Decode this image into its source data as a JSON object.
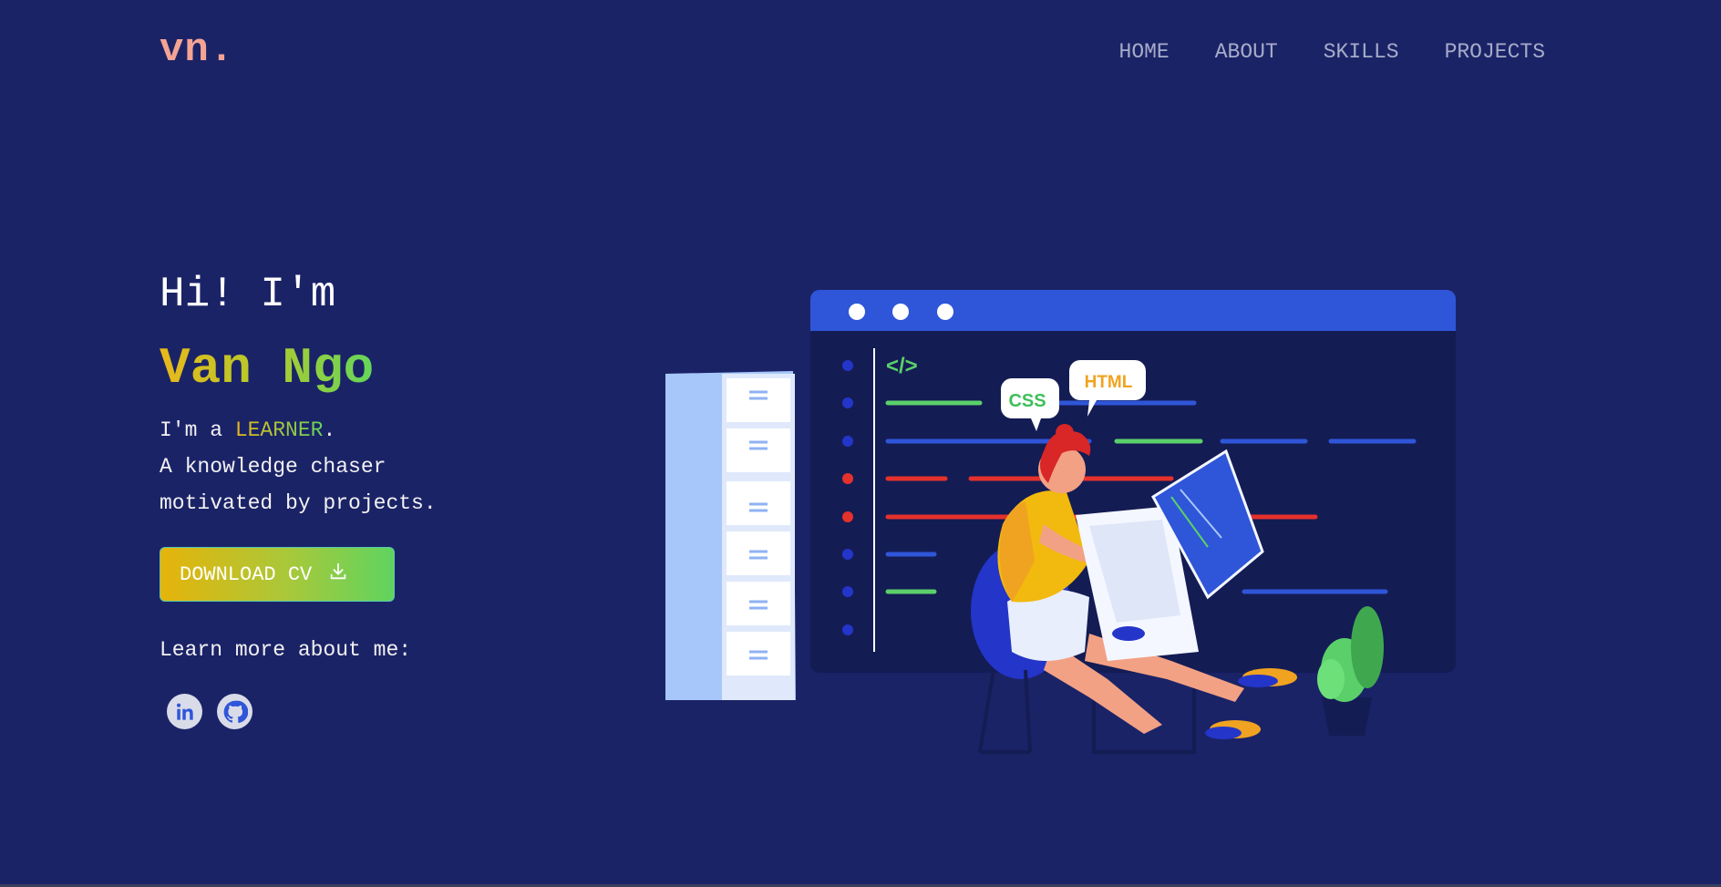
{
  "nav": {
    "logo": "vn.",
    "links": [
      "HOME",
      "ABOUT",
      "SKILLS",
      "PROJECTS"
    ]
  },
  "hero": {
    "greeting": "Hi! I'm",
    "name": "Van Ngo",
    "bio_prefix": "I'm a ",
    "role": "LEARNER",
    "bio_period": ".",
    "bio_line2": "A knowledge chaser",
    "bio_line3": "motivated by projects.",
    "cv_button": "DOWNLOAD CV",
    "learn_more": "Learn more about me:",
    "socials": [
      "linkedin-icon",
      "github-icon"
    ]
  },
  "illustration": {
    "code_tag": "</>",
    "bubble_css": "CSS",
    "bubble_html": "HTML"
  },
  "colors": {
    "background": "#1b2367",
    "logo": "#f4a394",
    "accent_yellow": "#e9b81a",
    "accent_green": "#64d65a",
    "window_blue": "#2f56d8"
  }
}
